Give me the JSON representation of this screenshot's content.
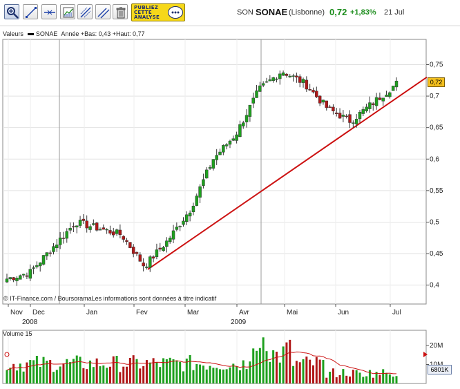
{
  "toolbar": {
    "tools": [
      "zoom-icon",
      "draw-line-icon",
      "horizontal-line-icon",
      "indicators-icon",
      "trend-line-icon",
      "parallel-line-icon",
      "trash-icon"
    ],
    "ad_text": "PUBLIEZ\nCETTE\nANALYSE"
  },
  "ticker": {
    "symbol": "SON",
    "name": "SONAE",
    "market": "(Lisbonne)",
    "price": "0,72",
    "change": "+1,83%",
    "date": "21 Jul"
  },
  "legend": {
    "label": "Valeurs",
    "series": "SONAE",
    "stats": "Année +Bas: 0,43 +Haut: 0,77"
  },
  "credit": "© IT-Finance.com / BoursoramaLes informations sont données à titre indicatif",
  "price_badge": "0,72",
  "volume": {
    "label": "Volume 15",
    "badge": "6801K",
    "axis_labels": [
      "20M",
      "10M"
    ]
  },
  "colors": {
    "up": "#1ea01e",
    "down": "#b01818",
    "trend": "#cc1010",
    "badge": "#f3bf1d",
    "volume_ma": "#cc1010"
  },
  "chart_data": [
    {
      "type": "candlestick",
      "title": "SONAE",
      "x_labels": [
        "Nov",
        "Dec",
        "Jan",
        "Fev",
        "Mar",
        "Avr",
        "Mai",
        "Jun",
        "Jul"
      ],
      "year_labels": [
        "2008",
        "2009"
      ],
      "y_ticks": [
        "0,75",
        "0,7",
        "0,65",
        "0,6",
        "0,55",
        "0,5",
        "0,45",
        "0,4"
      ],
      "ylim": [
        0.37,
        0.79
      ],
      "close_trend": [
        [
          "Nov",
          0.41
        ],
        [
          "Dec",
          0.42
        ],
        [
          "Dec",
          0.46
        ],
        [
          "Jan",
          0.5
        ],
        [
          "Jan",
          0.49
        ],
        [
          "Fev",
          0.48
        ],
        [
          "Fev",
          0.43
        ],
        [
          "Mar",
          0.47
        ],
        [
          "Mar",
          0.52
        ],
        [
          "Avr",
          0.6
        ],
        [
          "Avr",
          0.64
        ],
        [
          "Avr",
          0.71
        ],
        [
          "Mai",
          0.74
        ],
        [
          "Mai",
          0.72
        ],
        [
          "Jun",
          0.68
        ],
        [
          "Jun",
          0.66
        ],
        [
          "Jul",
          0.69
        ],
        [
          "Jul",
          0.72
        ]
      ],
      "trend_line": {
        "from": [
          "Fev",
          0.425
        ],
        "to": [
          "Jul",
          0.73
        ]
      },
      "grid": true
    },
    {
      "type": "bar",
      "title": "Volume 15",
      "y_ticks": [
        "20M",
        "10M"
      ],
      "ylim": [
        0,
        28000000
      ],
      "last_value": "6801K"
    }
  ]
}
